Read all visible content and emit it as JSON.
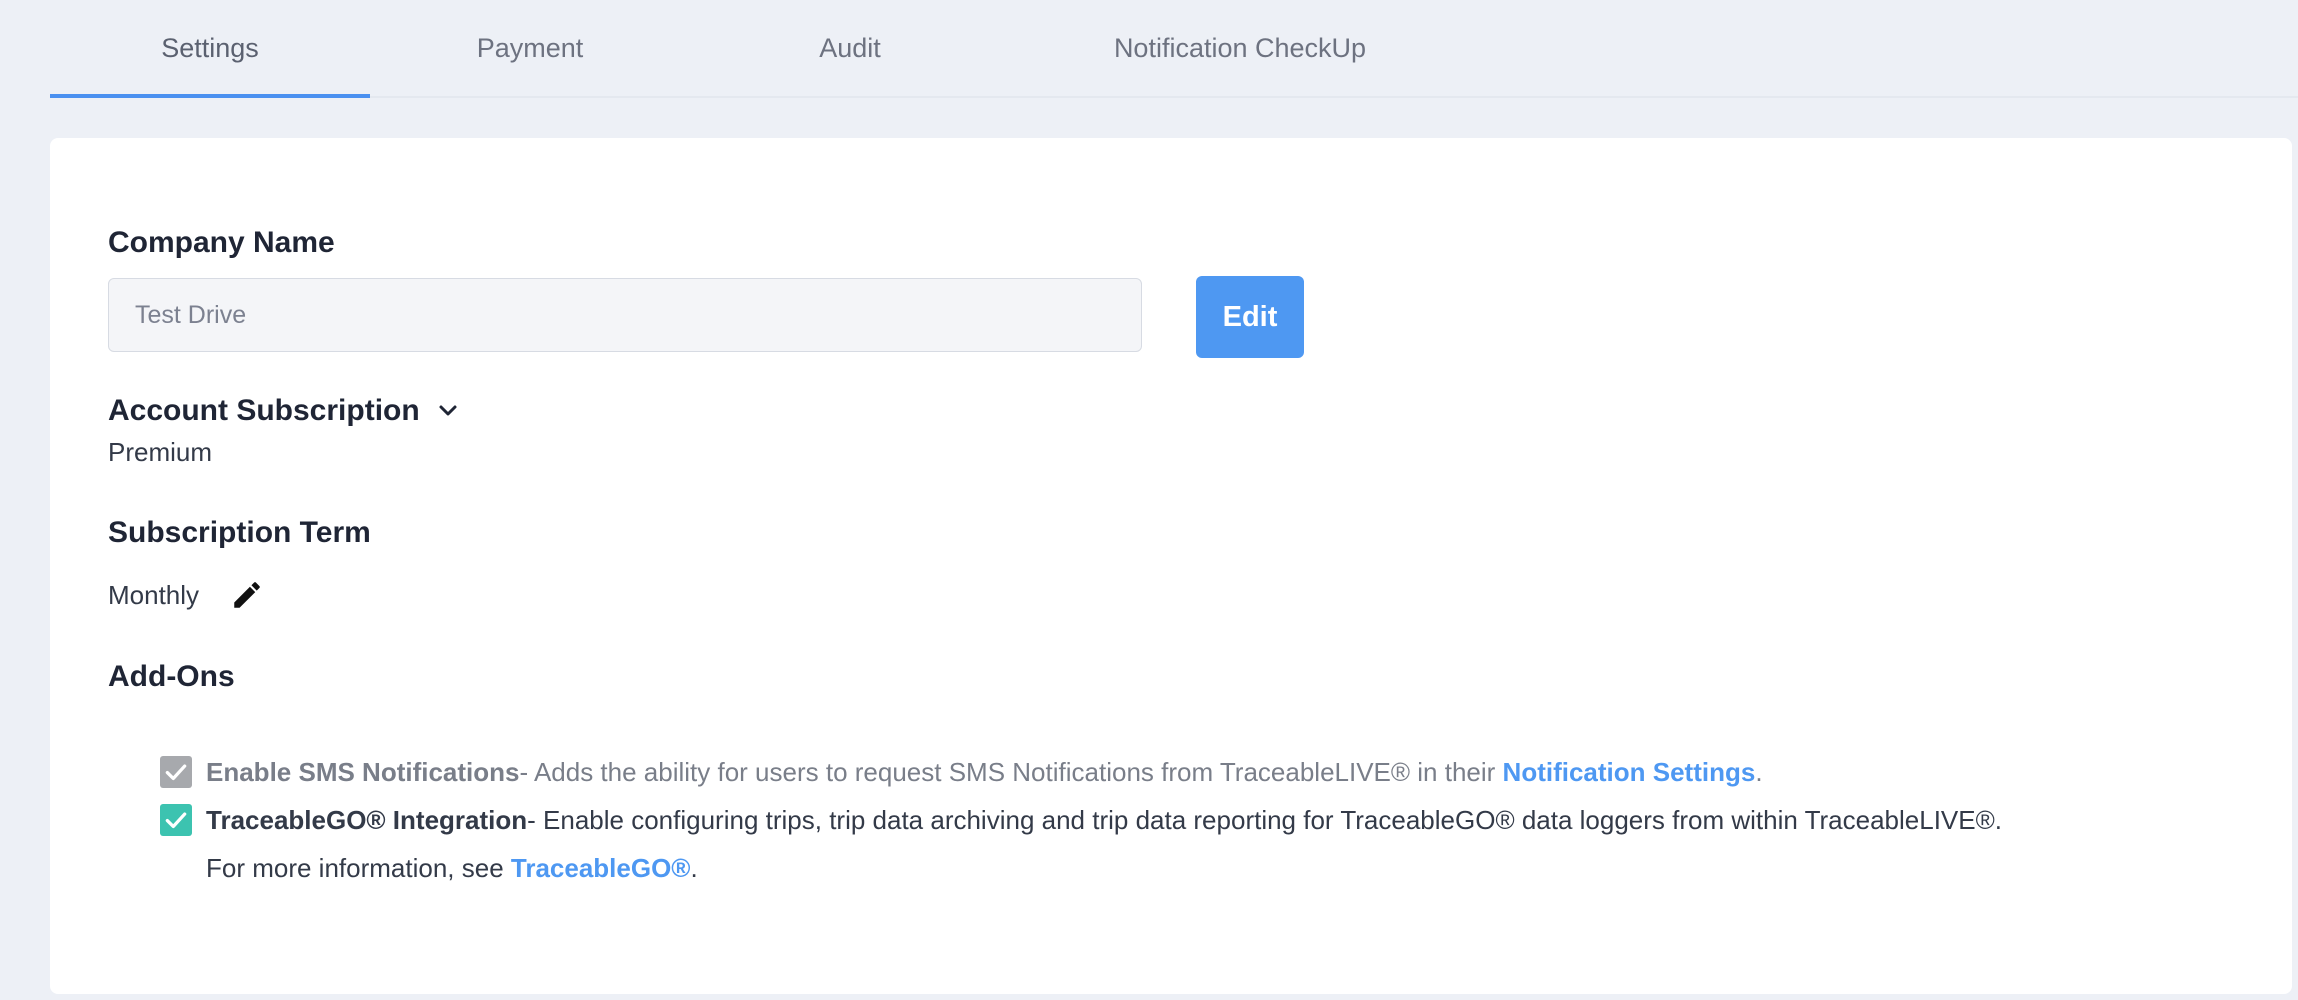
{
  "tabs": [
    {
      "label": "Settings",
      "active": true
    },
    {
      "label": "Payment"
    },
    {
      "label": "Audit"
    },
    {
      "label": "Notification CheckUp"
    }
  ],
  "company": {
    "label": "Company Name",
    "value": "Test Drive",
    "edit_label": "Edit"
  },
  "subscription": {
    "label": "Account Subscription",
    "value": "Premium"
  },
  "term": {
    "label": "Subscription Term",
    "value": "Monthly"
  },
  "addons": {
    "label": "Add-Ons",
    "sms": {
      "title": "Enable SMS Notifications",
      "desc": "- Adds the ability for users to request SMS Notifications from TraceableLIVE® in their ",
      "link": "Notification Settings",
      "end": ".",
      "checked": true
    },
    "go": {
      "title": "TraceableGO® Integration",
      "desc": "- Enable configuring trips, trip data archiving and trip data reporting for TraceableGO® data loggers from within TraceableLIVE®.",
      "more": "For more information, see ",
      "link": "TraceableGO®",
      "end": ".",
      "checked": true
    }
  },
  "colors": {
    "accent": "#4e98f2",
    "teal": "#3cc3b0",
    "gray_check": "#a7a9ad"
  }
}
